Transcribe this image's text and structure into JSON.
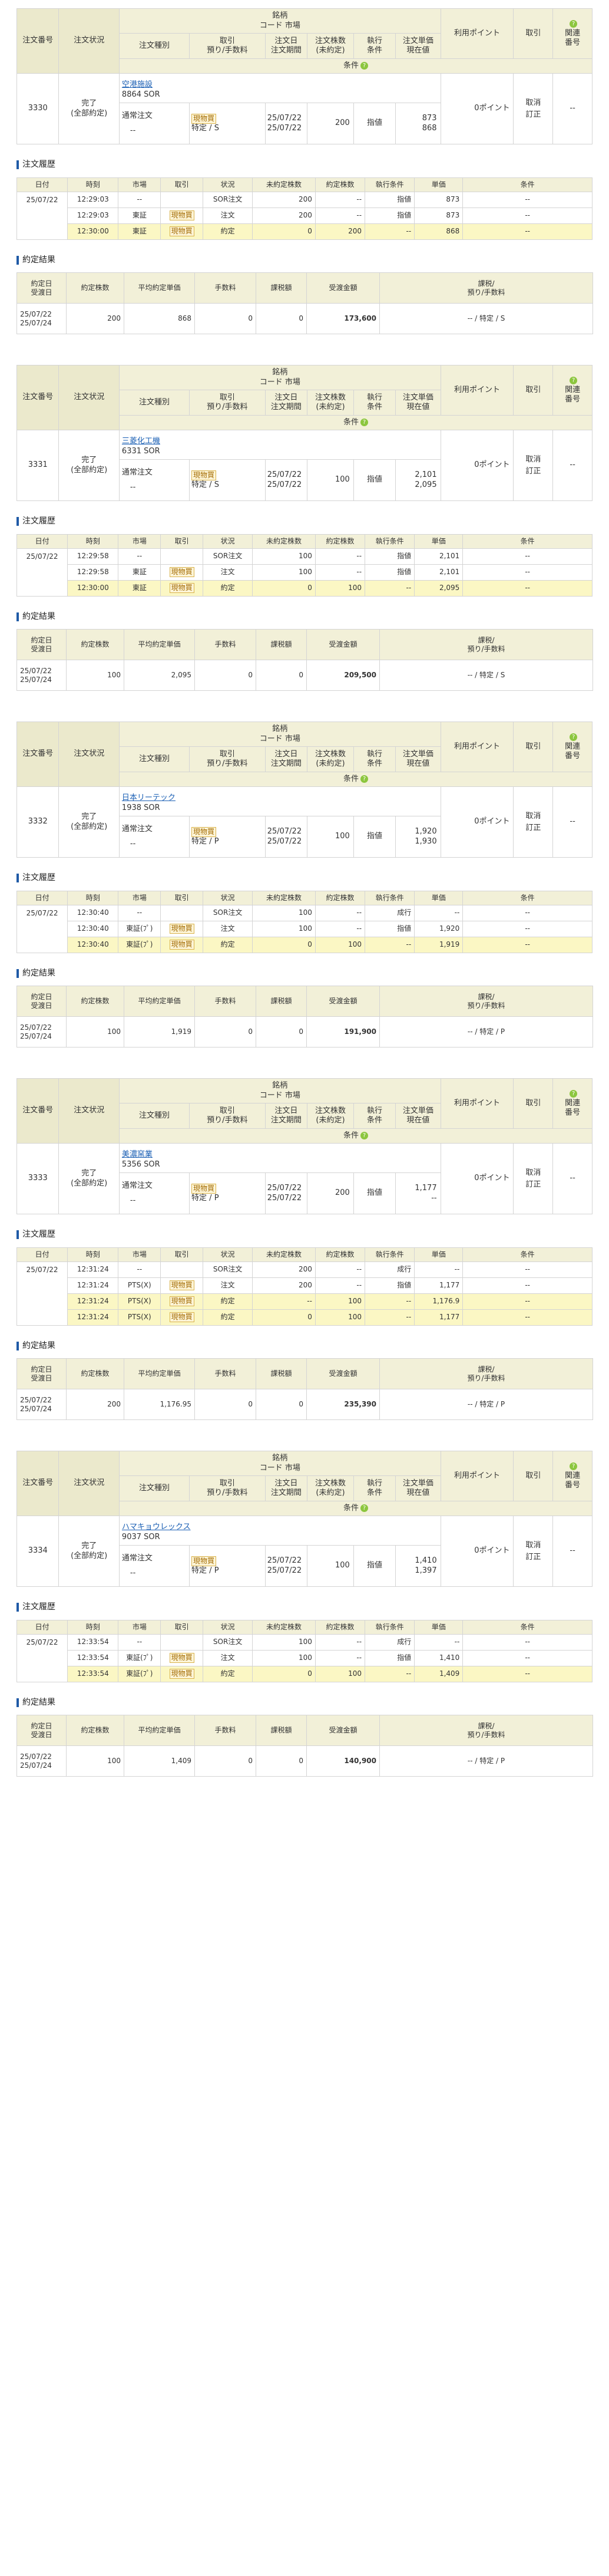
{
  "order_header": {
    "order_no": "注文番号",
    "status": "注文状況",
    "stock": "銘柄",
    "code_market": "コード 市場",
    "order_type": "注文種別",
    "trade_fee": [
      "取引",
      "預り/手数料"
    ],
    "order_date_period": [
      "注文日",
      "注文期間"
    ],
    "qty_unfilled": [
      "注文株数",
      "(未約定)"
    ],
    "exec_cond": [
      "執行",
      "条件"
    ],
    "price_current": [
      "注文単価",
      "現在値"
    ],
    "point": "利用ポイント",
    "trade": "取引",
    "related": [
      "関連",
      "番号"
    ],
    "condition": "条件"
  },
  "history_title": "注文履歴",
  "history_header": [
    "日付",
    "時刻",
    "市場",
    "取引",
    "状況",
    "未約定株数",
    "約定株数",
    "執行条件",
    "単価",
    "条件"
  ],
  "fill_title": "約定結果",
  "fill_header": {
    "date": [
      "約定日",
      "受渡日"
    ],
    "qty": "約定株数",
    "avg": "平均約定単価",
    "fee": "手数料",
    "tax": "課税額",
    "amount": "受渡金額",
    "tax_fee": [
      "課税/",
      "預り/手数料"
    ]
  },
  "orders": [
    {
      "no": "3330",
      "status": [
        "完了",
        "(全部約定)"
      ],
      "stock_name": "空港施設",
      "code_market": "8864 SOR",
      "order_type": "通常注文",
      "trade_kind": "現物買",
      "account": "特定 / S",
      "date": "25/07/22",
      "period": "25/07/22",
      "qty": "200",
      "exec": "指値",
      "price": "873",
      "current": "868",
      "cond_dash": "--",
      "point": "0ポイント",
      "cancel": [
        "取消",
        "訂正"
      ],
      "related": "--",
      "history": [
        {
          "date": "25/07/22",
          "time": "12:29:03",
          "market": "--",
          "trade": "",
          "status": "SOR注文",
          "unfilled": "200",
          "filled": "--",
          "exec": "指値",
          "price": "873",
          "cond": "--",
          "hl": false
        },
        {
          "date": "",
          "time": "12:29:03",
          "market": "東証",
          "trade": "現物買",
          "status": "注文",
          "unfilled": "200",
          "filled": "--",
          "exec": "指値",
          "price": "873",
          "cond": "--",
          "hl": false
        },
        {
          "date": "",
          "time": "12:30:00",
          "market": "東証",
          "trade": "現物買",
          "status": "約定",
          "unfilled": "0",
          "filled": "200",
          "exec": "--",
          "price": "868",
          "cond": "--",
          "hl": true
        }
      ],
      "fill": {
        "date": "25/07/22",
        "settle": "25/07/24",
        "qty": "200",
        "avg": "868",
        "fee": "0",
        "tax": "0",
        "amount": "173,600",
        "tax_fee": "-- / 特定 / S"
      }
    },
    {
      "no": "3331",
      "status": [
        "完了",
        "(全部約定)"
      ],
      "stock_name": "三菱化工機",
      "code_market": "6331 SOR",
      "order_type": "通常注文",
      "trade_kind": "現物買",
      "account": "特定 / S",
      "date": "25/07/22",
      "period": "25/07/22",
      "qty": "100",
      "exec": "指値",
      "price": "2,101",
      "current": "2,095",
      "cond_dash": "--",
      "point": "0ポイント",
      "cancel": [
        "取消",
        "訂正"
      ],
      "related": "--",
      "history": [
        {
          "date": "25/07/22",
          "time": "12:29:58",
          "market": "--",
          "trade": "",
          "status": "SOR注文",
          "unfilled": "100",
          "filled": "--",
          "exec": "指値",
          "price": "2,101",
          "cond": "--",
          "hl": false
        },
        {
          "date": "",
          "time": "12:29:58",
          "market": "東証",
          "trade": "現物買",
          "status": "注文",
          "unfilled": "100",
          "filled": "--",
          "exec": "指値",
          "price": "2,101",
          "cond": "--",
          "hl": false
        },
        {
          "date": "",
          "time": "12:30:00",
          "market": "東証",
          "trade": "現物買",
          "status": "約定",
          "unfilled": "0",
          "filled": "100",
          "exec": "--",
          "price": "2,095",
          "cond": "--",
          "hl": true
        }
      ],
      "fill": {
        "date": "25/07/22",
        "settle": "25/07/24",
        "qty": "100",
        "avg": "2,095",
        "fee": "0",
        "tax": "0",
        "amount": "209,500",
        "tax_fee": "-- / 特定 / S"
      }
    },
    {
      "no": "3332",
      "status": [
        "完了",
        "(全部約定)"
      ],
      "stock_name": "日本リーテック",
      "code_market": "1938 SOR",
      "order_type": "通常注文",
      "trade_kind": "現物買",
      "account": "特定 / P",
      "date": "25/07/22",
      "period": "25/07/22",
      "qty": "100",
      "exec": "指値",
      "price": "1,920",
      "current": "1,930",
      "cond_dash": "--",
      "point": "0ポイント",
      "cancel": [
        "取消",
        "訂正"
      ],
      "related": "--",
      "history": [
        {
          "date": "25/07/22",
          "time": "12:30:40",
          "market": "--",
          "trade": "",
          "status": "SOR注文",
          "unfilled": "100",
          "filled": "--",
          "exec": "成行",
          "price": "--",
          "cond": "--",
          "hl": false
        },
        {
          "date": "",
          "time": "12:30:40",
          "market": "東証(ﾌﾟ)",
          "trade": "現物買",
          "status": "注文",
          "unfilled": "100",
          "filled": "--",
          "exec": "指値",
          "price": "1,920",
          "cond": "--",
          "hl": false
        },
        {
          "date": "",
          "time": "12:30:40",
          "market": "東証(ﾌﾟ)",
          "trade": "現物買",
          "status": "約定",
          "unfilled": "0",
          "filled": "100",
          "exec": "--",
          "price": "1,919",
          "cond": "--",
          "hl": true
        }
      ],
      "fill": {
        "date": "25/07/22",
        "settle": "25/07/24",
        "qty": "100",
        "avg": "1,919",
        "fee": "0",
        "tax": "0",
        "amount": "191,900",
        "tax_fee": "-- / 特定 / P"
      }
    },
    {
      "no": "3333",
      "status": [
        "完了",
        "(全部約定)"
      ],
      "stock_name": "美濃窯業",
      "code_market": "5356 SOR",
      "order_type": "通常注文",
      "trade_kind": "現物買",
      "account": "特定 / P",
      "date": "25/07/22",
      "period": "25/07/22",
      "qty": "200",
      "exec": "指値",
      "price": "1,177",
      "current": "--",
      "cond_dash": "--",
      "point": "0ポイント",
      "cancel": [
        "取消",
        "訂正"
      ],
      "related": "--",
      "history": [
        {
          "date": "25/07/22",
          "time": "12:31:24",
          "market": "--",
          "trade": "",
          "status": "SOR注文",
          "unfilled": "200",
          "filled": "--",
          "exec": "成行",
          "price": "--",
          "cond": "--",
          "hl": false
        },
        {
          "date": "",
          "time": "12:31:24",
          "market": "PTS(X)",
          "trade": "現物買",
          "status": "注文",
          "unfilled": "200",
          "filled": "--",
          "exec": "指値",
          "price": "1,177",
          "cond": "--",
          "hl": false
        },
        {
          "date": "",
          "time": "12:31:24",
          "market": "PTS(X)",
          "trade": "現物買",
          "status": "約定",
          "unfilled": "--",
          "filled": "100",
          "exec": "--",
          "price": "1,176.9",
          "cond": "--",
          "hl": true
        },
        {
          "date": "",
          "time": "12:31:24",
          "market": "PTS(X)",
          "trade": "現物買",
          "status": "約定",
          "unfilled": "0",
          "filled": "100",
          "exec": "--",
          "price": "1,177",
          "cond": "--",
          "hl": true
        }
      ],
      "fill": {
        "date": "25/07/22",
        "settle": "25/07/24",
        "qty": "200",
        "avg": "1,176.95",
        "fee": "0",
        "tax": "0",
        "amount": "235,390",
        "tax_fee": "-- / 特定 / P"
      }
    },
    {
      "no": "3334",
      "status": [
        "完了",
        "(全部約定)"
      ],
      "stock_name": "ハマキョウレックス",
      "code_market": "9037 SOR",
      "order_type": "通常注文",
      "trade_kind": "現物買",
      "account": "特定 / P",
      "date": "25/07/22",
      "period": "25/07/22",
      "qty": "100",
      "exec": "指値",
      "price": "1,410",
      "current": "1,397",
      "cond_dash": "--",
      "point": "0ポイント",
      "cancel": [
        "取消",
        "訂正"
      ],
      "related": "--",
      "history": [
        {
          "date": "25/07/22",
          "time": "12:33:54",
          "market": "--",
          "trade": "",
          "status": "SOR注文",
          "unfilled": "100",
          "filled": "--",
          "exec": "成行",
          "price": "--",
          "cond": "--",
          "hl": false
        },
        {
          "date": "",
          "time": "12:33:54",
          "market": "東証(ﾌﾟ)",
          "trade": "現物買",
          "status": "注文",
          "unfilled": "100",
          "filled": "--",
          "exec": "指値",
          "price": "1,410",
          "cond": "--",
          "hl": false
        },
        {
          "date": "",
          "time": "12:33:54",
          "market": "東証(ﾌﾟ)",
          "trade": "現物買",
          "status": "約定",
          "unfilled": "0",
          "filled": "100",
          "exec": "--",
          "price": "1,409",
          "cond": "--",
          "hl": true
        }
      ],
      "fill": {
        "date": "25/07/22",
        "settle": "25/07/24",
        "qty": "100",
        "avg": "1,409",
        "fee": "0",
        "tax": "0",
        "amount": "140,900",
        "tax_fee": "-- / 特定 / P"
      }
    }
  ],
  "colors": {
    "header_bg": "#f2f0d8",
    "highlight_row": "#fbf7c4",
    "section_bar": "#1f5aa6",
    "link": "#1a5fb4",
    "cond_icon": "#8cc63e"
  },
  "icons": {
    "condition": "question-circle-icon",
    "related": "question-circle-icon"
  }
}
